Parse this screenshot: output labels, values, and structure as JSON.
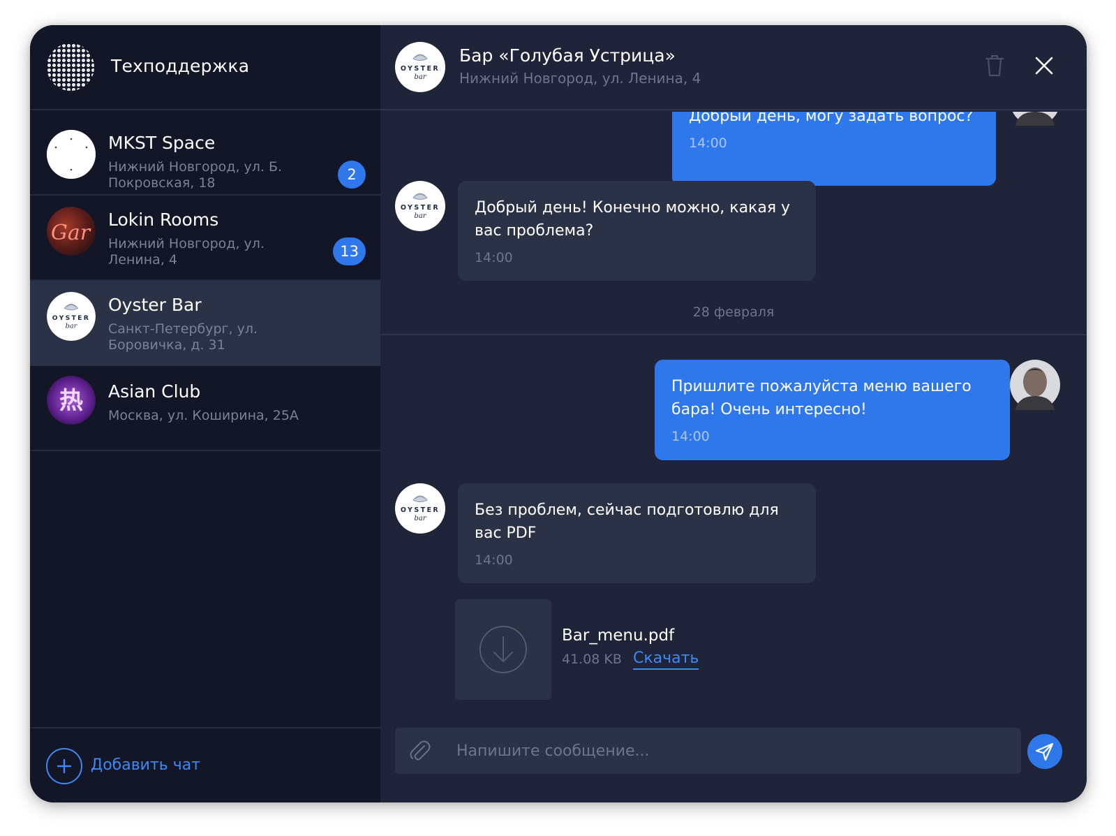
{
  "sidebar": {
    "title": "Техподдержка",
    "chats": [
      {
        "name": "MKST Space",
        "address": "Нижний Новгород, ул. Б. Покровская, 18",
        "unread": "2"
      },
      {
        "name": "Lokin Rooms",
        "address": "Нижний Новгород, ул. Ленина, 4",
        "unread": "13",
        "avatar_text": "Gar"
      },
      {
        "name": "Oyster Bar",
        "address": "Санкт-Петербург, ул. Боровичка, д. 31",
        "active": true
      },
      {
        "name": "Asian Club",
        "address": "Москва, ул. Коширина, 25А",
        "avatar_text": "热"
      }
    ],
    "add_chat_label": "Добавить чат"
  },
  "header": {
    "title": "Бар «Голубая Устрица»",
    "subtitle": "Нижний Новгород, ул. Ленина, 4",
    "icons": [
      "trash-icon",
      "close-icon"
    ]
  },
  "logo": {
    "line1": "OYSTER",
    "line2": "bar"
  },
  "messages": [
    {
      "direction": "out",
      "text": "Добрый день, могу задать вопрос?",
      "time": "14:00"
    },
    {
      "direction": "in",
      "text": "Добрый день! Конечно можно, какая у вас проблема?",
      "time": "14:00"
    },
    {
      "direction": "out",
      "text": "Пришлите пожалуйста меню вашего бара! Очень интересно!",
      "time": "14:00"
    },
    {
      "direction": "in",
      "text": "Без проблем, сейчас подготовлю для вас PDF",
      "time": "14:00"
    }
  ],
  "date_separator": "28 февраля",
  "attachment": {
    "name": "Bar_menu.pdf",
    "size": "41.08 KB",
    "download_label": "Скачать"
  },
  "composer": {
    "placeholder": "Напишите сообщение..."
  },
  "colors": {
    "accent": "#2f78ec",
    "sidebar_bg": "#121627",
    "main_bg": "#1f2438",
    "bubble_in": "#2c3246"
  }
}
